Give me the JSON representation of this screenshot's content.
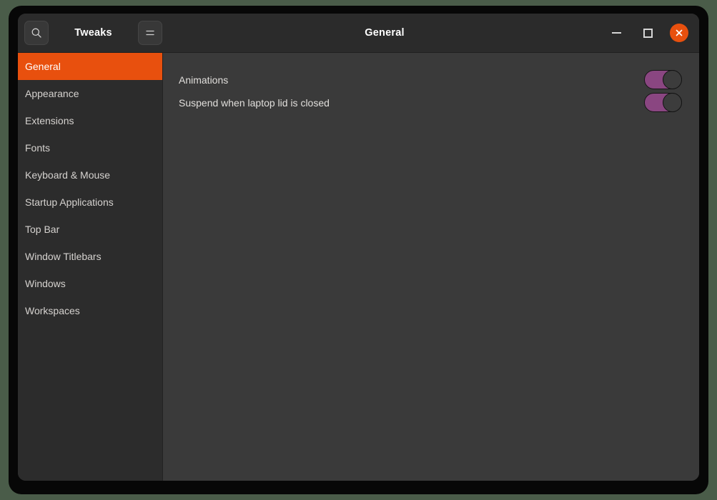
{
  "window": {
    "app_title": "Tweaks",
    "page_title": "General"
  },
  "header": {
    "search_icon": "search-icon",
    "menu_icon": "hamburger-menu-icon",
    "minimize_label": "Minimize",
    "maximize_label": "Maximize",
    "close_label": "Close",
    "close_color": "#e8500e"
  },
  "sidebar": {
    "selected": "General",
    "accent_color": "#e8500e",
    "items": [
      {
        "label": "General",
        "selected": true
      },
      {
        "label": "Appearance",
        "selected": false
      },
      {
        "label": "Extensions",
        "selected": false
      },
      {
        "label": "Fonts",
        "selected": false
      },
      {
        "label": "Keyboard & Mouse",
        "selected": false
      },
      {
        "label": "Startup Applications",
        "selected": false
      },
      {
        "label": "Top Bar",
        "selected": false
      },
      {
        "label": "Window Titlebars",
        "selected": false
      },
      {
        "label": "Windows",
        "selected": false
      },
      {
        "label": "Workspaces",
        "selected": false
      }
    ]
  },
  "content": {
    "toggle_on_color": "#8a4681",
    "settings": [
      {
        "label": "Animations",
        "state": "on"
      },
      {
        "label": "Suspend when laptop lid is closed",
        "state": "on"
      }
    ]
  }
}
